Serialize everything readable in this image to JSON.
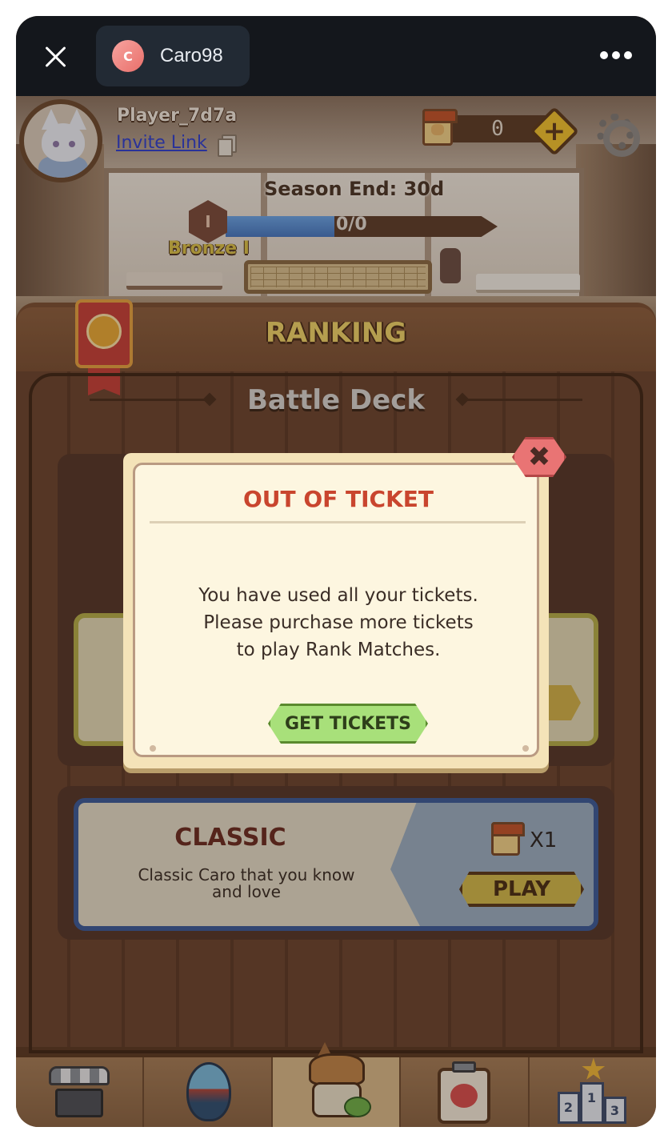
{
  "topbar": {
    "app_avatar_letter": "C",
    "app_name": "Caro98"
  },
  "header": {
    "player_name": "Player_7d7a",
    "invite_link_label": "Invite Link",
    "ticket_count": "0",
    "add_symbol": "+"
  },
  "season": {
    "end_label": "Season End: 30d",
    "rank_badge": "I",
    "progress_label": "0/0",
    "progress_fraction": 0.4,
    "rank_name": "Bronze I"
  },
  "panel": {
    "title": "RANKING",
    "deck_title": "Battle Deck"
  },
  "classic_card": {
    "title": "CLASSIC",
    "description": "Classic Caro that you know and love",
    "cost": "X1",
    "play_label": "PLAY"
  },
  "modal": {
    "title": "OUT OF TICKET",
    "message": "You have used all your tickets.\nPlease purchase more tickets\nto play Rank Matches.",
    "button_label": "GET TICKETS",
    "close_symbol": "✖"
  },
  "bottom_nav": [
    {
      "icon": "shop-icon"
    },
    {
      "icon": "egg-icon"
    },
    {
      "icon": "home-icon",
      "active": true
    },
    {
      "icon": "clipboard-icon"
    },
    {
      "icon": "leaderboard-icon"
    }
  ],
  "podium_numbers": [
    "2",
    "1",
    "3"
  ],
  "colors": {
    "accent_gold": "#f0d46a",
    "modal_title_red": "#c9452e",
    "progress_blue": "#4577c2",
    "button_green": "#a8e07a"
  }
}
